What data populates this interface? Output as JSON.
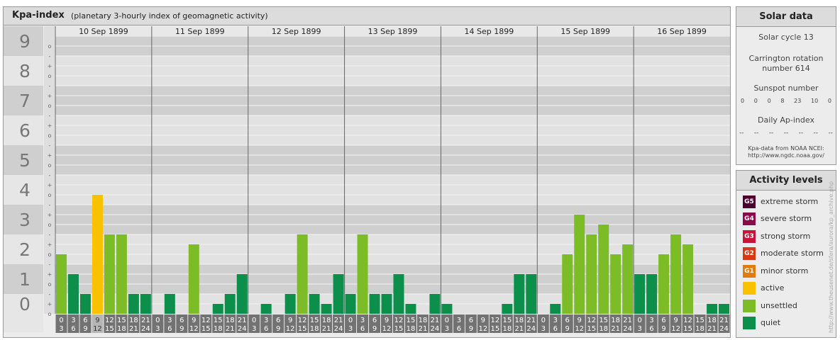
{
  "title": {
    "main": "Kpa-index",
    "subtitle": "(planetary 3-hourly index of geomagnetic activity)"
  },
  "chart_data": {
    "type": "bar",
    "y_axis_labels": [
      "0",
      "1",
      "2",
      "3",
      "4",
      "5",
      "6",
      "7",
      "8",
      "9"
    ],
    "ylim": [
      0,
      9
    ],
    "sub_tick_labels": [
      "o",
      "+",
      "-",
      "o",
      "+",
      "-",
      "o",
      "+",
      "-",
      "o",
      "+",
      "-",
      "o",
      "+",
      "-",
      "o",
      "+",
      "-",
      "o",
      "+",
      "-",
      "o",
      "+",
      "-",
      "o",
      "+",
      "-",
      "o"
    ],
    "days": [
      {
        "date": "10 Sep 1899",
        "values": [
          2.0,
          1.333,
          0.667,
          4.0,
          2.667,
          2.667,
          0.667,
          0.667
        ]
      },
      {
        "date": "11 Sep 1899",
        "values": [
          0,
          0.667,
          0,
          2.333,
          0,
          0.333,
          0.667,
          1.333
        ]
      },
      {
        "date": "12 Sep 1899",
        "values": [
          0,
          0.333,
          0,
          0.667,
          2.667,
          0.667,
          0.333,
          1.333
        ]
      },
      {
        "date": "13 Sep 1899",
        "values": [
          0.667,
          2.667,
          0.667,
          0.667,
          1.333,
          0.333,
          0,
          0.667
        ]
      },
      {
        "date": "14 Sep 1899",
        "values": [
          0.333,
          0,
          0,
          0,
          0,
          0.333,
          1.333,
          1.333
        ]
      },
      {
        "date": "15 Sep 1899",
        "values": [
          0,
          0.333,
          2.0,
          3.333,
          2.667,
          3.0,
          2.0,
          2.333
        ]
      },
      {
        "date": "16 Sep 1899",
        "values": [
          1.333,
          1.333,
          2.0,
          2.667,
          2.333,
          0,
          0.333,
          0.333
        ]
      }
    ],
    "hour_labels": [
      [
        "0",
        "3"
      ],
      [
        "3",
        "6"
      ],
      [
        "6",
        "9"
      ],
      [
        "9",
        "12"
      ],
      [
        "12",
        "15"
      ],
      [
        "15",
        "18"
      ],
      [
        "18",
        "21"
      ],
      [
        "21",
        "24"
      ]
    ],
    "level_colors": {
      "quiet": "#0b8f4a",
      "unsettled": "#7cbd27",
      "active": "#f8c200",
      "G1": "#e07b10",
      "G2": "#d63a13",
      "G3": "#c4153a",
      "G4": "#8a0a4a",
      "G5": "#4b0030"
    }
  },
  "solar": {
    "heading": "Solar data",
    "cycle": "Solar cycle 13",
    "carrington_line1": "Carrington rotation",
    "carrington_line2": "number 614",
    "sunspot_label": "Sunspot number",
    "sunspot_values": [
      "0",
      "0",
      "0",
      "8",
      "23",
      "10",
      "0"
    ],
    "ap_label": "Daily Ap-index",
    "ap_values": [
      "--",
      "--",
      "--",
      "--",
      "--",
      "--",
      "--"
    ],
    "source_line1": "Kpa-data from NOAA NCEI:",
    "source_line2": "http://www.ngdc.noaa.gov/"
  },
  "activity": {
    "heading": "Activity levels",
    "items": [
      {
        "badge": "G5",
        "label": "extreme storm",
        "color": "#4b0030"
      },
      {
        "badge": "G4",
        "label": "severe storm",
        "color": "#8a0a4a"
      },
      {
        "badge": "G3",
        "label": "strong storm",
        "color": "#c4153a"
      },
      {
        "badge": "G2",
        "label": "moderate storm",
        "color": "#d63a13"
      },
      {
        "badge": "G1",
        "label": "minor storm",
        "color": "#e07b10"
      },
      {
        "badge": "",
        "label": "active",
        "color": "#f8c200"
      },
      {
        "badge": "",
        "label": "unsettled",
        "color": "#7cbd27"
      },
      {
        "badge": "",
        "label": "quiet",
        "color": "#0b8f4a"
      }
    ]
  },
  "watermark": "http://www.theusenet.de/sfera/aurora/kp_archive.php"
}
